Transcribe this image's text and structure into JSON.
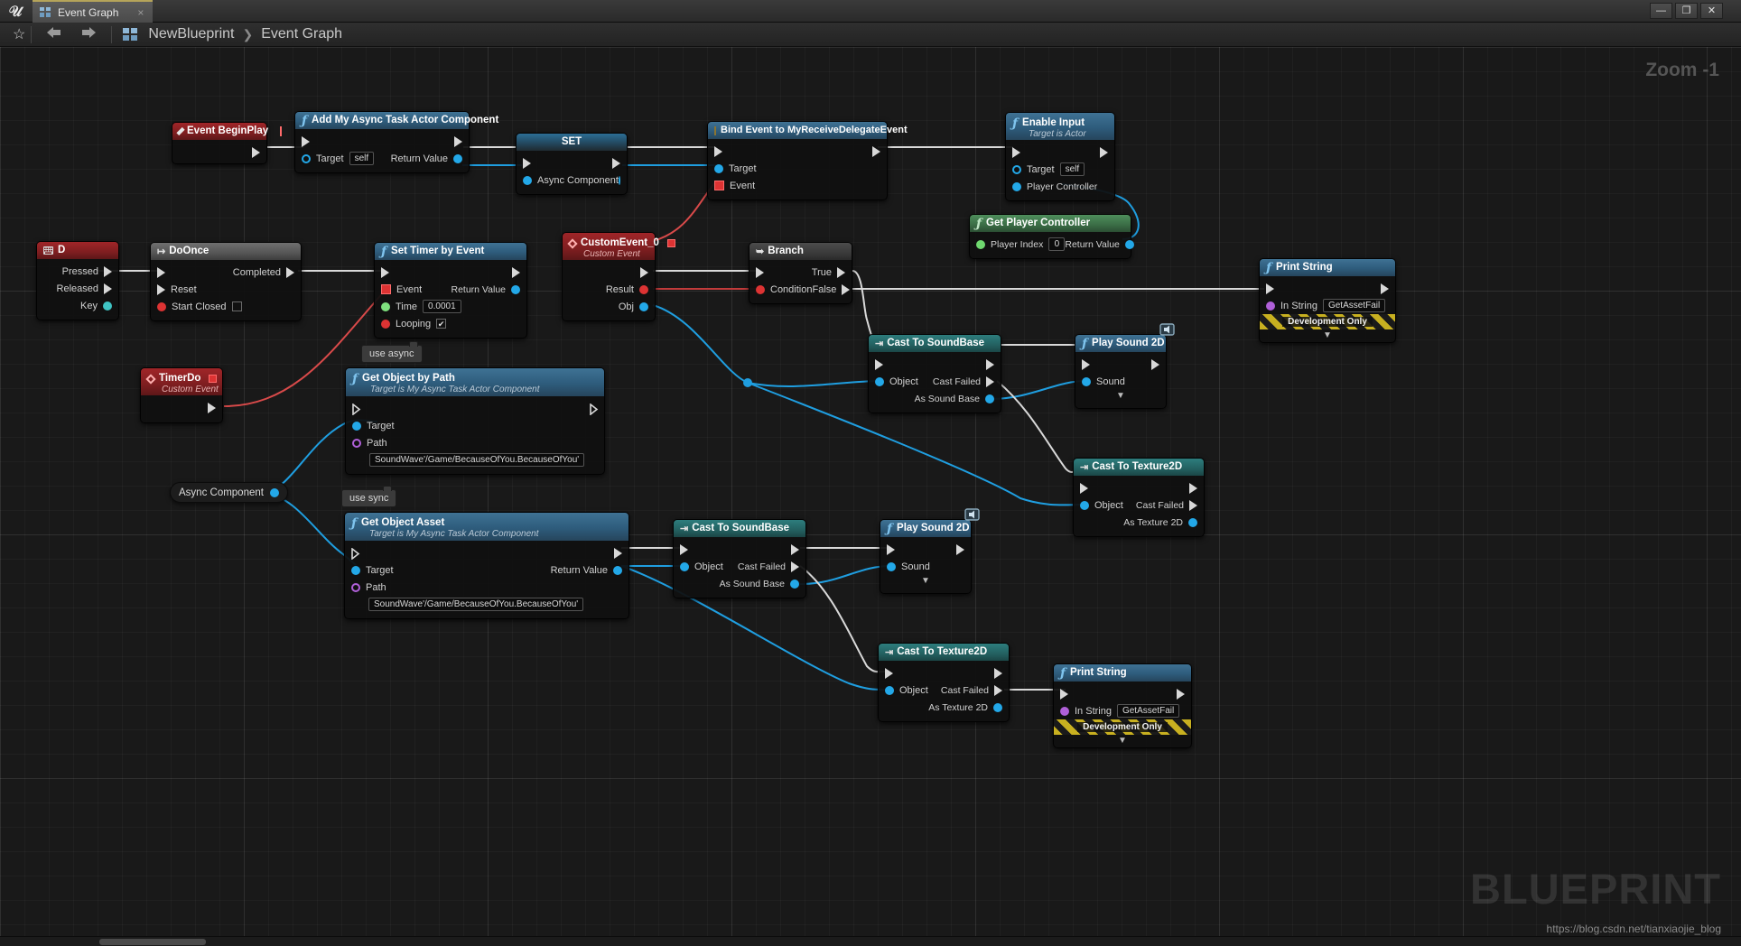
{
  "window": {
    "app": "Unreal Editor",
    "logo_glyph": "U",
    "tab_label": "Event Graph",
    "tab_close": "×",
    "minimize": "—",
    "maximize": "❐",
    "close": "✕"
  },
  "toolbar": {
    "star": "☆",
    "back": "⬅",
    "forward": "➡",
    "breadcrumb": {
      "root": "NewBlueprint",
      "separator": "❯",
      "current": "Event Graph"
    }
  },
  "canvas": {
    "zoom_label": "Zoom -1",
    "watermark": "BLUEPRINT",
    "blog_url": "https://blog.csdn.net/tianxiaojie_blog"
  },
  "colors": {
    "exec_wire": "#d9d9d9",
    "data_wire": "#1f9ee0",
    "delegate_wire": "#d94a4a",
    "node_header_function": "#3f7294",
    "node_header_event": "#a02528",
    "node_header_macro": "#6f6f6f",
    "node_header_cast": "#2d7d7d",
    "accent_blue": "#23a8e8",
    "accent_red": "#d33333",
    "accent_purple": "#b060d8",
    "dev_only_stripe": "#c8b020"
  },
  "chips": [
    {
      "id": "chip-use-async",
      "label": "use async"
    },
    {
      "id": "chip-use-sync",
      "label": "use sync"
    }
  ],
  "variables": [
    {
      "id": "var-async-component",
      "label": "Async Component"
    }
  ],
  "nodes": [
    {
      "id": "event-beginplay",
      "title": "Event BeginPlay",
      "subtitle": "",
      "icon": "event-diamond-icon",
      "header_style": "red",
      "outputs": [
        {
          "label": "",
          "pin": "exec"
        }
      ],
      "inputs": []
    },
    {
      "id": "add-my-async-task-actor-component",
      "title": "Add My Async Task Actor Component",
      "subtitle": "",
      "icon": "function-f-icon",
      "header_style": "blue",
      "inputs": [
        {
          "label": "",
          "pin": "exec"
        },
        {
          "label": "Target",
          "pin": "object",
          "value": "self"
        }
      ],
      "outputs": [
        {
          "label": "",
          "pin": "exec"
        },
        {
          "label": "Return Value",
          "pin": "object"
        }
      ]
    },
    {
      "id": "set-async-component",
      "title": "SET",
      "subtitle": "",
      "icon": "",
      "header_style": "set",
      "inputs": [
        {
          "label": "",
          "pin": "exec"
        },
        {
          "label": "Async Component",
          "pin": "object"
        }
      ],
      "outputs": [
        {
          "label": "",
          "pin": "exec"
        },
        {
          "label": "",
          "pin": "object"
        }
      ]
    },
    {
      "id": "bind-event-to-myreceivedelegateevent",
      "title": "Bind Event to MyReceiveDelegateEvent",
      "subtitle": "",
      "icon": "bind-event-icon",
      "header_style": "bind",
      "inputs": [
        {
          "label": "",
          "pin": "exec"
        },
        {
          "label": "Target",
          "pin": "object"
        },
        {
          "label": "Event",
          "pin": "delegate"
        }
      ],
      "outputs": [
        {
          "label": "",
          "pin": "exec"
        }
      ]
    },
    {
      "id": "enable-input",
      "title": "Enable Input",
      "subtitle": "Target is Actor",
      "icon": "function-f-icon",
      "header_style": "blue",
      "inputs": [
        {
          "label": "",
          "pin": "exec"
        },
        {
          "label": "Target",
          "pin": "object",
          "value": "self"
        },
        {
          "label": "Player Controller",
          "pin": "object"
        }
      ],
      "outputs": [
        {
          "label": "",
          "pin": "exec"
        }
      ]
    },
    {
      "id": "get-player-controller",
      "title": "Get Player Controller",
      "subtitle": "",
      "icon": "function-f-icon",
      "header_style": "blue",
      "inputs": [
        {
          "label": "Player Index",
          "pin": "int",
          "value": "0"
        }
      ],
      "outputs": [
        {
          "label": "Return Value",
          "pin": "object"
        }
      ]
    },
    {
      "id": "input-key-d",
      "title": "D",
      "subtitle": "",
      "icon": "keyboard-icon",
      "header_style": "red",
      "inputs": [],
      "outputs": [
        {
          "label": "Pressed",
          "pin": "exec"
        },
        {
          "label": "Released",
          "pin": "exec"
        },
        {
          "label": "Key",
          "pin": "struct"
        }
      ]
    },
    {
      "id": "do-once",
      "title": "DoOnce",
      "subtitle": "",
      "icon": "macro-icon",
      "header_style": "gray",
      "inputs": [
        {
          "label": "",
          "pin": "exec"
        },
        {
          "label": "Reset",
          "pin": "exec"
        },
        {
          "label": "Start Closed",
          "pin": "bool",
          "value": "false"
        }
      ],
      "outputs": [
        {
          "label": "Completed",
          "pin": "exec"
        }
      ]
    },
    {
      "id": "set-timer-by-event",
      "title": "Set Timer by Event",
      "subtitle": "",
      "icon": "function-f-icon",
      "header_style": "blue",
      "inputs": [
        {
          "label": "",
          "pin": "exec"
        },
        {
          "label": "Event",
          "pin": "delegate"
        },
        {
          "label": "Time",
          "pin": "float",
          "value": "0.0001"
        },
        {
          "label": "Looping",
          "pin": "bool",
          "value": "true"
        }
      ],
      "outputs": [
        {
          "label": "",
          "pin": "exec"
        },
        {
          "label": "Return Value",
          "pin": "struct"
        }
      ]
    },
    {
      "id": "timerdo-custom-event",
      "title": "TimerDo",
      "subtitle": "Custom Event",
      "icon": "event-diamond-icon",
      "header_style": "red",
      "inputs": [],
      "outputs": [
        {
          "label": "",
          "pin": "exec"
        }
      ]
    },
    {
      "id": "customevent-0",
      "title": "CustomEvent_0",
      "subtitle": "Custom Event",
      "icon": "event-diamond-icon",
      "header_style": "red",
      "inputs": [],
      "outputs": [
        {
          "label": "",
          "pin": "exec"
        },
        {
          "label": "Result",
          "pin": "bool"
        },
        {
          "label": "Obj",
          "pin": "object"
        }
      ]
    },
    {
      "id": "branch",
      "title": "Branch",
      "subtitle": "",
      "icon": "branch-icon",
      "header_style": "dgray",
      "inputs": [
        {
          "label": "",
          "pin": "exec"
        },
        {
          "label": "Condition",
          "pin": "bool"
        }
      ],
      "outputs": [
        {
          "label": "True",
          "pin": "exec"
        },
        {
          "label": "False",
          "pin": "exec"
        }
      ]
    },
    {
      "id": "get-object-by-path",
      "title": "Get Object by Path",
      "subtitle": "Target is My Async Task Actor Component",
      "icon": "function-f-icon",
      "header_style": "blue",
      "inputs": [
        {
          "label": "",
          "pin": "exec"
        },
        {
          "label": "Target",
          "pin": "object"
        },
        {
          "label": "Path",
          "pin": "string",
          "value": "SoundWave'/Game/BecauseOfYou.BecauseOfYou'"
        }
      ],
      "outputs": [
        {
          "label": "",
          "pin": "exec"
        }
      ]
    },
    {
      "id": "get-object-asset",
      "title": "Get Object Asset",
      "subtitle": "Target is My Async Task Actor Component",
      "icon": "function-f-icon",
      "header_style": "blue",
      "inputs": [
        {
          "label": "",
          "pin": "exec"
        },
        {
          "label": "Target",
          "pin": "object"
        },
        {
          "label": "Path",
          "pin": "string",
          "value": "SoundWave'/Game/BecauseOfYou.BecauseOfYou'"
        }
      ],
      "outputs": [
        {
          "label": "",
          "pin": "exec"
        },
        {
          "label": "Return Value",
          "pin": "object"
        }
      ]
    },
    {
      "id": "cast-to-soundbase-top",
      "title": "Cast To SoundBase",
      "subtitle": "",
      "icon": "cast-icon",
      "header_style": "teal",
      "inputs": [
        {
          "label": "",
          "pin": "exec"
        },
        {
          "label": "Object",
          "pin": "object"
        }
      ],
      "outputs": [
        {
          "label": "",
          "pin": "exec"
        },
        {
          "label": "Cast Failed",
          "pin": "exec"
        },
        {
          "label": "As Sound Base",
          "pin": "object"
        }
      ]
    },
    {
      "id": "play-sound-2d-top",
      "title": "Play Sound 2D",
      "subtitle": "",
      "icon": "function-f-icon",
      "header_style": "blue",
      "inputs": [
        {
          "label": "",
          "pin": "exec"
        },
        {
          "label": "Sound",
          "pin": "object"
        }
      ],
      "outputs": [
        {
          "label": "",
          "pin": "exec"
        }
      ]
    },
    {
      "id": "cast-to-texture2d-top",
      "title": "Cast To Texture2D",
      "subtitle": "",
      "icon": "cast-icon",
      "header_style": "teal",
      "inputs": [
        {
          "label": "",
          "pin": "exec"
        },
        {
          "label": "Object",
          "pin": "object"
        }
      ],
      "outputs": [
        {
          "label": "",
          "pin": "exec"
        },
        {
          "label": "Cast Failed",
          "pin": "exec"
        },
        {
          "label": "As Texture 2D",
          "pin": "object"
        }
      ]
    },
    {
      "id": "print-string-top",
      "title": "Print String",
      "subtitle": "",
      "icon": "function-f-icon",
      "header_style": "blue",
      "inputs": [
        {
          "label": "",
          "pin": "exec"
        },
        {
          "label": "In String",
          "pin": "string",
          "value": "GetAssetFail"
        }
      ],
      "outputs": [
        {
          "label": "",
          "pin": "exec"
        }
      ],
      "footer": "Development Only"
    },
    {
      "id": "cast-to-soundbase-bottom",
      "title": "Cast To SoundBase",
      "subtitle": "",
      "icon": "cast-icon",
      "header_style": "teal",
      "inputs": [
        {
          "label": "",
          "pin": "exec"
        },
        {
          "label": "Object",
          "pin": "object"
        }
      ],
      "outputs": [
        {
          "label": "",
          "pin": "exec"
        },
        {
          "label": "Cast Failed",
          "pin": "exec"
        },
        {
          "label": "As Sound Base",
          "pin": "object"
        }
      ]
    },
    {
      "id": "play-sound-2d-bottom",
      "title": "Play Sound 2D",
      "subtitle": "",
      "icon": "function-f-icon",
      "header_style": "blue",
      "inputs": [
        {
          "label": "",
          "pin": "exec"
        },
        {
          "label": "Sound",
          "pin": "object"
        }
      ],
      "outputs": [
        {
          "label": "",
          "pin": "exec"
        }
      ]
    },
    {
      "id": "cast-to-texture2d-bottom",
      "title": "Cast To Texture2D",
      "subtitle": "",
      "icon": "cast-icon",
      "header_style": "teal",
      "inputs": [
        {
          "label": "",
          "pin": "exec"
        },
        {
          "label": "Object",
          "pin": "object"
        }
      ],
      "outputs": [
        {
          "label": "",
          "pin": "exec"
        },
        {
          "label": "Cast Failed",
          "pin": "exec"
        },
        {
          "label": "As Texture 2D",
          "pin": "object"
        }
      ]
    },
    {
      "id": "print-string-bottom",
      "title": "Print String",
      "subtitle": "",
      "icon": "function-f-icon",
      "header_style": "blue",
      "inputs": [
        {
          "label": "",
          "pin": "exec"
        },
        {
          "label": "In String",
          "pin": "string",
          "value": "GetAssetFail"
        }
      ],
      "outputs": [
        {
          "label": "",
          "pin": "exec"
        }
      ],
      "footer": "Development Only"
    }
  ],
  "labels": {
    "target": "Target",
    "return_value": "Return Value",
    "async_component": "Async Component",
    "event": "Event",
    "player_controller": "Player Controller",
    "player_index": "Player Index",
    "pressed": "Pressed",
    "released": "Released",
    "key": "Key",
    "completed": "Completed",
    "reset": "Reset",
    "start_closed": "Start Closed",
    "time": "Time",
    "looping": "Looping",
    "result": "Result",
    "obj": "Obj",
    "condition": "Condition",
    "true": "True",
    "false": "False",
    "path": "Path",
    "object": "Object",
    "cast_failed": "Cast Failed",
    "as_sound_base": "As Sound Base",
    "as_texture_2d": "As Texture 2D",
    "sound": "Sound",
    "in_string": "In String",
    "development_only": "Development Only",
    "expander": "▼",
    "self": "self"
  }
}
